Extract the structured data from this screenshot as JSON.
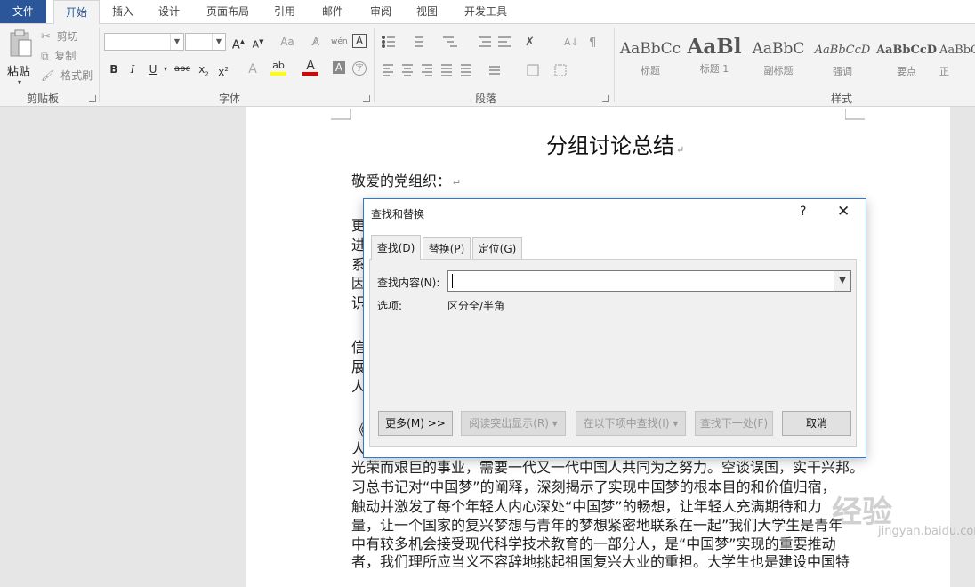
{
  "ribbon": {
    "tabs": [
      "文件",
      "开始",
      "插入",
      "设计",
      "页面布局",
      "引用",
      "邮件",
      "审阅",
      "视图",
      "开发工具"
    ],
    "clipboard": {
      "paste": "粘贴",
      "cut": "剪切",
      "copy": "复制",
      "format_painter": "格式刷",
      "label": "剪贴板"
    },
    "font": {
      "label": "字体",
      "clear_format": "Aa",
      "phonetic": "wén",
      "text_effect": "A"
    },
    "paragraph": {
      "label": "段落"
    },
    "styles": {
      "label": "样式",
      "items": [
        {
          "sample": "AaBbCc",
          "name": "标题"
        },
        {
          "sample": "AaBl",
          "name": "标题 1"
        },
        {
          "sample": "AaBbC",
          "name": "副标题"
        },
        {
          "sample": "AaBbCcD",
          "name": "强调"
        },
        {
          "sample": "AaBbCcD",
          "name": "要点"
        },
        {
          "sample": "AaBbC",
          "name": "正"
        }
      ]
    }
  },
  "document": {
    "title": "分组讨论总结",
    "lines": [
      "敬爱的党组织：",
      "更",
      "进",
      "系",
      "因",
      "识",
      "信",
      "展",
      "人",
      "《",
      "人",
      "光荣而艰巨的事业，需要一代又一代中国人共同为之努力。空谈误国，实干兴邦。",
      "习总书记对“中国梦”的阐释，深刻揭示了实现中国梦的根本目的和价值归宿，",
      "触动并激发了每个年轻人内心深处“中国梦”的畅想，让年轻人充满期待和力",
      "量，让一个国家的复兴梦想与青年的梦想紧密地联系在一起”我们大学生是青年",
      "中有较多机会接受现代科学技术教育的一部分人，是“中国梦”实现的重要推动",
      "者，我们理所应当义不容辞地挑起祖国复兴大业的重担。大学生也是建设中国特"
    ],
    "watermark": "经验",
    "watermark_sub": "jingyan.baidu.com"
  },
  "dialog": {
    "title": "查找和替换",
    "help": "?",
    "tabs": [
      "查找(D)",
      "替换(P)",
      "定位(G)"
    ],
    "find_label": "查找内容(N):",
    "find_value": "",
    "options_label": "选项:",
    "options_value": "区分全/半角",
    "buttons": {
      "more": "更多(M) >>",
      "reading_highlight": "阅读突出显示(R)",
      "find_in": "在以下项中查找(I)",
      "find_next": "查找下一处(F)",
      "cancel": "取消"
    }
  }
}
